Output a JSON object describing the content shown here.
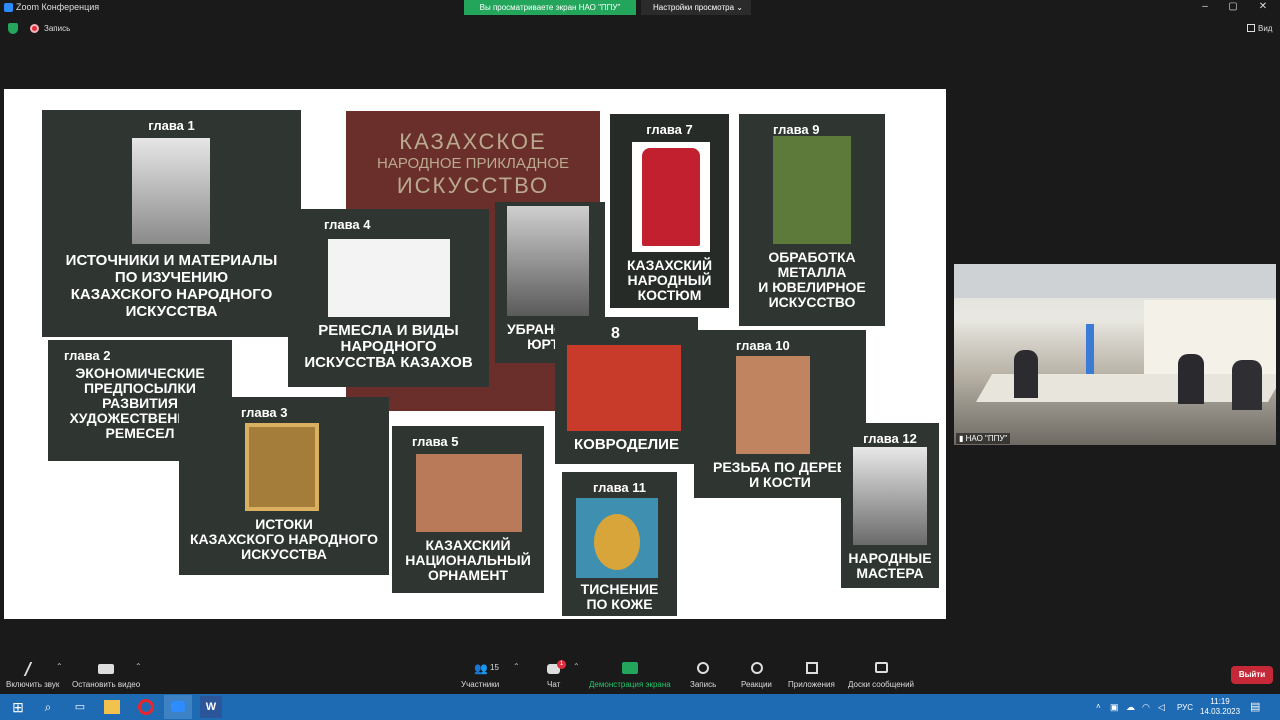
{
  "window": {
    "title": "Zoom Конференция"
  },
  "share_banner": "Вы просматриваете экран НАО \"ППУ\"",
  "view_options": "Настройки просмотра",
  "recording_label": "Запись",
  "view_label": "Вид",
  "slide": {
    "book_title": [
      "КАЗАХСКОЕ",
      "НАРОДНОЕ ПРИКЛАДНОЕ",
      "ИСКУССТВО"
    ],
    "chapters": [
      {
        "id": 1,
        "label": "глава 1",
        "title": [
          "ИСТОЧНИКИ И МАТЕРИАЛЫ",
          "ПО ИЗУЧЕНИЮ",
          "КАЗАХСКОГО НАРОДНОГО",
          "ИСКУССТВА"
        ]
      },
      {
        "id": 2,
        "label": "глава 2",
        "title": [
          "ЭКОНОМИЧЕСКИЕ",
          "ПРЕДПОСЫЛКИ",
          "РАЗВИТИЯ",
          "ХУДОЖЕСТВЕННЫХ",
          "РЕМЕСЕЛ"
        ]
      },
      {
        "id": 3,
        "label": "глава 3",
        "title": [
          "ИСТОКИ",
          "КАЗАХСКОГО НАРОДНОГО",
          "ИСКУССТВА"
        ]
      },
      {
        "id": 4,
        "label": "глава 4",
        "title": [
          "РЕМЕСЛА И ВИДЫ",
          "НАРОДНОГО",
          "ИСКУССТВА КАЗАХОВ"
        ]
      },
      {
        "id": 5,
        "label": "глава 5",
        "title": [
          "КАЗАХСКИЙ",
          "НАЦИОНАЛЬНЫЙ",
          "ОРНАМЕНТ"
        ]
      },
      {
        "id": 6,
        "label": "",
        "title": [
          "УБРАНСТВО",
          "ЮРТЫ"
        ]
      },
      {
        "id": 7,
        "label": "глава 7",
        "title": [
          "КАЗАХСКИЙ",
          "НАРОДНЫЙ",
          "КОСТЮМ"
        ]
      },
      {
        "id": 8,
        "label": "8",
        "title": [
          "КОВРОДЕЛИЕ"
        ]
      },
      {
        "id": 9,
        "label": "глава 9",
        "title": [
          "ОБРАБОТКА",
          "МЕТАЛЛА",
          "И ЮВЕЛИРНОЕ",
          "ИСКУССТВО"
        ]
      },
      {
        "id": 10,
        "label": "глава 10",
        "title": [
          "РЕЗЬБА ПО ДЕРЕВ",
          "И КОСТИ"
        ]
      },
      {
        "id": 11,
        "label": "глава 11",
        "title": [
          "ТИСНЕНИЕ",
          "ПО КОЖЕ"
        ]
      },
      {
        "id": 12,
        "label": "глава 12",
        "title": [
          "НАРОДНЫЕ",
          "МАСТЕРА"
        ]
      }
    ]
  },
  "video": {
    "participant_name": "НАО \"ППУ\""
  },
  "toolbar": {
    "mute": "Включить звук",
    "video": "Остановить видео",
    "participants": "Участники",
    "participants_count": "15",
    "chat": "Чат",
    "chat_badge": "1",
    "share": "Демонстрация экрана",
    "record": "Запись",
    "reactions": "Реакции",
    "apps": "Приложения",
    "whiteboards": "Доски сообщений",
    "leave": "Выйти"
  },
  "taskbar": {
    "lang": "РУС",
    "time": "11:19",
    "date": "14.03.2023"
  },
  "colors": {
    "zoom_green": "#23a65c",
    "leave_red": "#c52836",
    "taskbar_blue": "#1e6bb3"
  }
}
